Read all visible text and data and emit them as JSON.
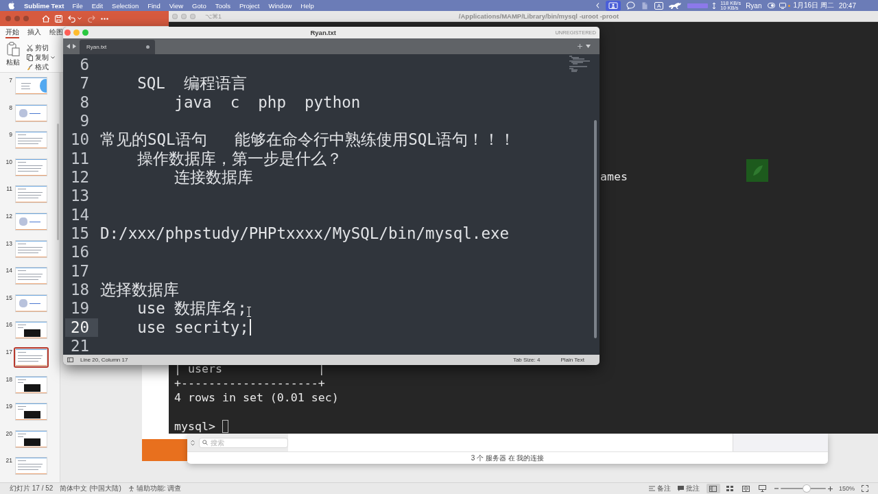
{
  "menu_bar": {
    "app_name": "Sublime Text",
    "menus": [
      "File",
      "Edit",
      "Selection",
      "Find",
      "View",
      "Goto",
      "Tools",
      "Project",
      "Window",
      "Help"
    ],
    "input_source": "A",
    "network_speed": {
      "upload": "118 KB/s",
      "download": "10 KB/s"
    },
    "user": "Ryan",
    "date": "1月16日 周二",
    "time": "20:47"
  },
  "presentation_window": {
    "ribbon_tabs": [
      {
        "label": "开始",
        "selected": true
      },
      {
        "label": "插入",
        "selected": false
      },
      {
        "label": "绘图",
        "selected": false
      }
    ],
    "clipboard": {
      "paste": "粘贴",
      "cut": "剪切",
      "copy": "复制",
      "format": "格式"
    },
    "slides": [
      {
        "number": "7",
        "kind": "title",
        "selected": false
      },
      {
        "number": "8",
        "kind": "image",
        "selected": false
      },
      {
        "number": "9",
        "kind": "text",
        "selected": false
      },
      {
        "number": "10",
        "kind": "text",
        "selected": false
      },
      {
        "number": "11",
        "kind": "text",
        "selected": false
      },
      {
        "number": "12",
        "kind": "image",
        "selected": false
      },
      {
        "number": "13",
        "kind": "text",
        "selected": false
      },
      {
        "number": "14",
        "kind": "text",
        "selected": false
      },
      {
        "number": "15",
        "kind": "image",
        "selected": false
      },
      {
        "number": "16",
        "kind": "terminal",
        "selected": false
      },
      {
        "number": "17",
        "kind": "text",
        "selected": true
      },
      {
        "number": "18",
        "kind": "terminal",
        "selected": false
      },
      {
        "number": "19",
        "kind": "terminal",
        "selected": false
      },
      {
        "number": "20",
        "kind": "terminal",
        "selected": false
      },
      {
        "number": "21",
        "kind": "text",
        "selected": false
      }
    ],
    "status_bar": {
      "slide_position": "幻灯片 17 / 52",
      "language": "简体中文 (中国大陆)",
      "accessibility": "辅助功能: 调查",
      "notes": "备注",
      "comments": "批注",
      "views": [
        {
          "kind": "normal",
          "selected": true
        },
        {
          "kind": "sorter",
          "selected": false
        },
        {
          "kind": "reading",
          "selected": false
        },
        {
          "kind": "slideshow",
          "selected": false
        }
      ],
      "zoom_slider": {
        "level": 0.57
      },
      "zoom": "150%"
    }
  },
  "terminal_window": {
    "shortcut": "⌥⌘1",
    "title": "/Applications/MAMP/Library/bin/mysql -uroot -proot",
    "lines": [
      {
        "kind": "fragment",
        "text": "ames"
      },
      {
        "kind": "output",
        "text": "| users              |"
      },
      {
        "kind": "output",
        "text": "+--------------------+"
      },
      {
        "kind": "output",
        "text": "4 rows in set (0.01 sec)"
      },
      {
        "kind": "prompt",
        "text": "mysql>"
      }
    ]
  },
  "server_window": {
    "search": {
      "placeholder": "搜索"
    },
    "status": "3 个 服务器 在 我的连接"
  },
  "editor_window": {
    "title": "Ryan.txt",
    "license": "UNREGISTERED",
    "tabs": [
      {
        "label": "Ryan.txt",
        "selected": true,
        "dirty": true
      }
    ],
    "lines": [
      {
        "number": "6",
        "current": false
      },
      {
        "number": "7",
        "text": "    SQL  编程语言",
        "current": false
      },
      {
        "number": "8",
        "text": "        java  c  php  python",
        "current": false
      },
      {
        "number": "9",
        "current": false
      },
      {
        "number": "10",
        "text": "常见的SQL语句   能够在命令行中熟练使用SQL语句！！！",
        "current": false
      },
      {
        "number": "11",
        "text": "    操作数据库，第一步是什么？",
        "current": false
      },
      {
        "number": "12",
        "text": "        连接数据库",
        "current": false
      },
      {
        "number": "13",
        "current": false
      },
      {
        "number": "14",
        "current": false
      },
      {
        "number": "15",
        "text": "D:/xxx/phpstudy/PHPtxxxx/MySQL/bin/mysql.exe",
        "current": false
      },
      {
        "number": "16",
        "current": false
      },
      {
        "number": "17",
        "current": false
      },
      {
        "number": "18",
        "text": "选择数据库",
        "current": false
      },
      {
        "number": "19",
        "text": "    use 数据库名;",
        "current": false
      },
      {
        "number": "20",
        "text": "    use secrity;",
        "current": true
      },
      {
        "number": "21",
        "current": false
      }
    ],
    "status_bar": {
      "position": "Line 20, Column 17",
      "tab_size": "Tab Size: 4",
      "syntax": "Plain Text"
    }
  }
}
